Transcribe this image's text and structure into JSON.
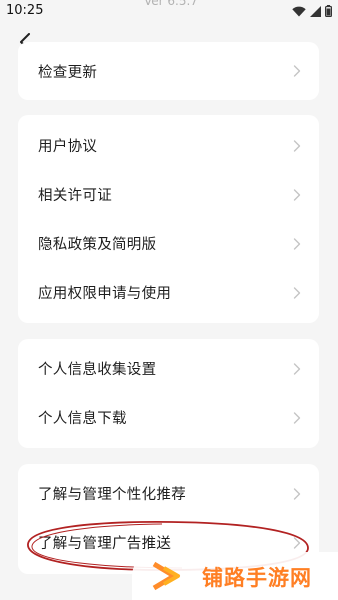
{
  "status_bar": {
    "time": "10:25",
    "version_text": "Ver 6.5.7",
    "icons": [
      "wifi-icon",
      "signal-icon",
      "battery-icon"
    ]
  },
  "header": {
    "back_icon": "chevron-left-icon"
  },
  "groups": [
    {
      "items": [
        {
          "label": "检查更新"
        }
      ]
    },
    {
      "items": [
        {
          "label": "用户协议"
        },
        {
          "label": "相关许可证"
        },
        {
          "label": "隐私政策及简明版"
        },
        {
          "label": "应用权限申请与使用"
        }
      ]
    },
    {
      "items": [
        {
          "label": "个人信息收集设置"
        },
        {
          "label": "个人信息下载"
        }
      ]
    },
    {
      "items": [
        {
          "label": "了解与管理个性化推荐"
        },
        {
          "label": "了解与管理广告推送"
        }
      ]
    }
  ],
  "annotation": {
    "color": "#b22222"
  },
  "watermark": {
    "text": "铺路手游网",
    "color": "#ff7f24"
  },
  "colors": {
    "background": "#f5f5f5",
    "card": "#ffffff",
    "chevron": "#c4c4c4"
  }
}
